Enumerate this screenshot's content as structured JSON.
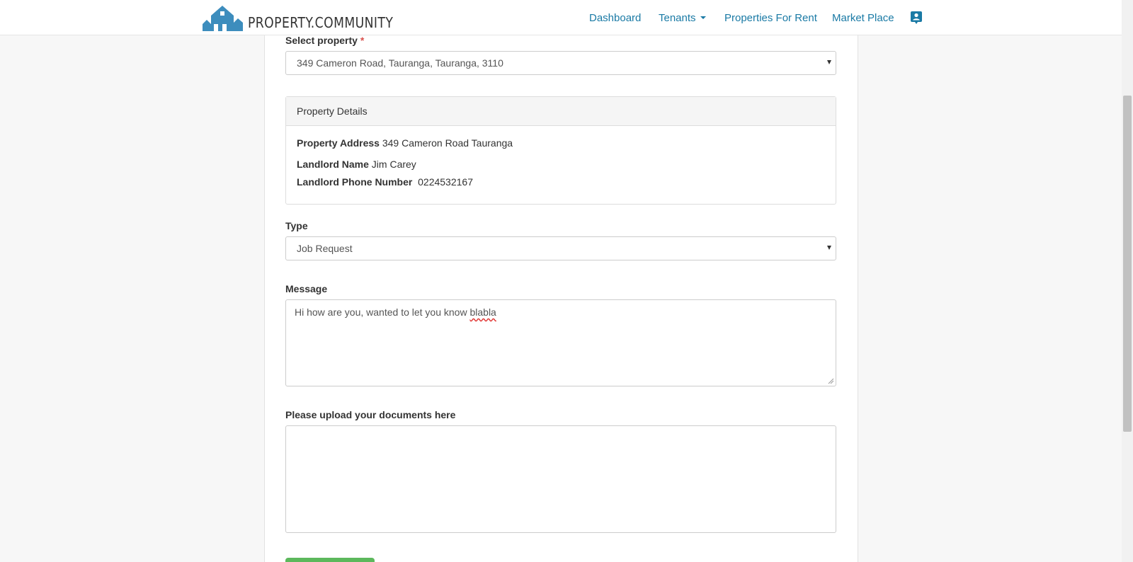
{
  "header": {
    "logo_text": "PROPERTY.COMMUNITY",
    "nav": {
      "dashboard": "Dashboard",
      "tenants": "Tenants",
      "properties_for_rent": "Properties For Rent",
      "market_place": "Market Place"
    },
    "profile_icon": "contact-card-icon"
  },
  "form": {
    "property_label": "Select property",
    "required_mark": "*",
    "property_value": "349 Cameron Road, Tauranga, Tauranga, 3110",
    "details": {
      "heading": "Property Details",
      "address_label": "Property Address",
      "address_value": "349 Cameron Road Tauranga",
      "landlord_label": "Landlord Name",
      "landlord_value": "Jim Carey",
      "phone_label": "Landlord Phone Number",
      "phone_value": "0224532167"
    },
    "type_label": "Type",
    "type_value": "Job Request",
    "message_label": "Message",
    "message_text": "Hi how are you, wanted to let you know ",
    "message_misspelled": "blabla",
    "upload_label": "Please upload your documents here"
  },
  "colors": {
    "brand": "#3d8dbd",
    "link": "#1a7aa5",
    "submit": "#5cb85c",
    "required": "#d9534f"
  }
}
